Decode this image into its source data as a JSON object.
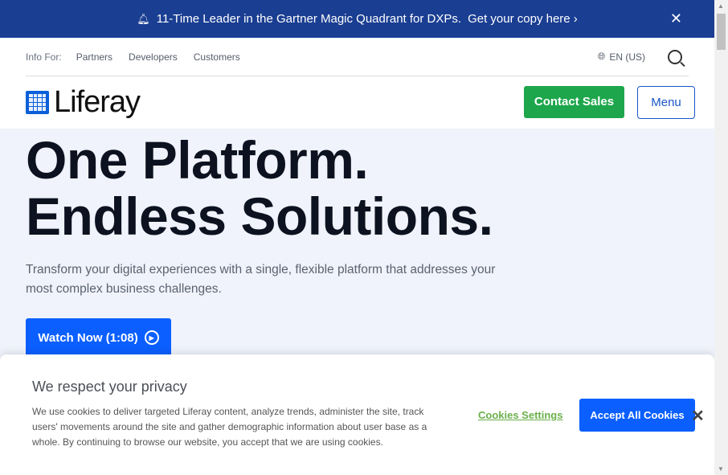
{
  "banner": {
    "text": "11-Time Leader in the Gartner Magic Quadrant for DXPs.",
    "cta": "Get your copy here ›",
    "close": "✕",
    "bell_icon": "bell-icon"
  },
  "topnav": {
    "label": "Info For:",
    "links": [
      "Partners",
      "Developers",
      "Customers"
    ],
    "language": "EN (US)"
  },
  "header": {
    "logo": "Liferay",
    "contact_sales": "Contact Sales",
    "menu": "Menu"
  },
  "hero": {
    "title_line1": "One Platform.",
    "title_line2": "Endless Solutions.",
    "description": "Transform your digital experiences with a single, flexible platform that addresses your most complex business challenges.",
    "watch": "Watch Now (1:08)"
  },
  "cookie": {
    "title": "We respect your privacy",
    "text": "We use cookies to deliver targeted Liferay content, analyze trends, administer the site, track users' movements around the site and gather demographic information about user base as a whole. By continuing to browse our website, you accept that we are using cookies.",
    "settings": "Cookies Settings",
    "accept": "Accept All Cookies",
    "close": "✕"
  },
  "colors": {
    "banner": "#1a3e92",
    "green": "#1ea64c",
    "blue": "#0b5fff",
    "hero_bg": "#f0f3fb"
  }
}
